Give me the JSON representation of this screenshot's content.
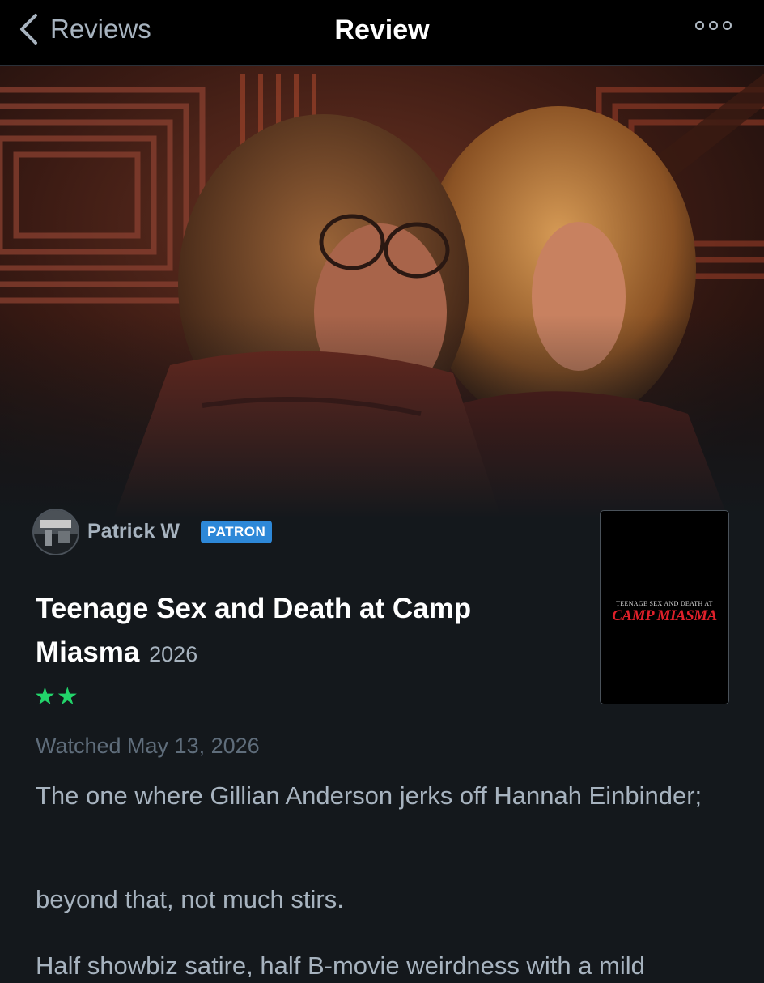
{
  "nav": {
    "back_label": "Reviews",
    "title": "Review"
  },
  "reviewer": {
    "name": "Patrick W",
    "badge": "PATRON"
  },
  "film": {
    "title": "Teenage Sex and Death at Camp Miasma",
    "year": "2026",
    "rating_stars": "★★",
    "rating_value": 2,
    "poster": {
      "small_text": "TEENAGE SEX AND  DEATH AT",
      "big_text": "CAMP MIASMA"
    }
  },
  "review": {
    "watched": "Watched May 13, 2026",
    "paragraphs": [
      "The one where Gillian Anderson jerks off Hannah Einbinder;",
      "beyond that, not much stirs.",
      "Half showbiz satire, half B-movie weirdness with a mild"
    ]
  },
  "colors": {
    "nav_bg": "#000000",
    "page_bg": "#14181c",
    "muted_text": "#a7b3bf",
    "dim_text": "#5f6d7b",
    "star_green": "#22d46a",
    "patron_blue": "#2d88d8",
    "poster_red": "#e0202a"
  },
  "icons": {
    "back": "chevron-left-icon",
    "more": "more-options-icon"
  }
}
